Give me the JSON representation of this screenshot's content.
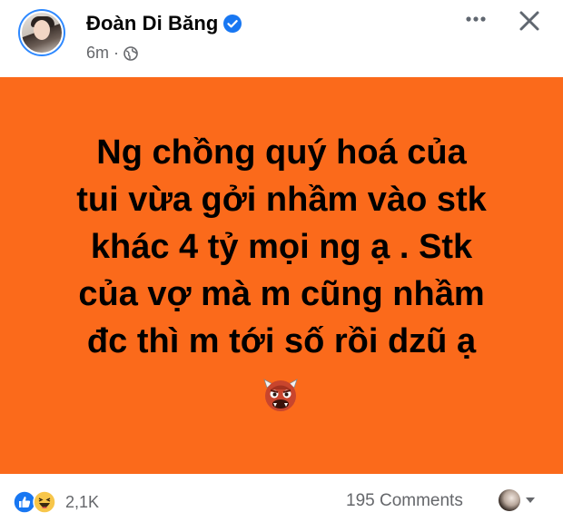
{
  "post": {
    "author_name": "Đoàn Di Băng",
    "timestamp": "6m",
    "separator": "·",
    "text_lines": [
      "Ng chồng quý hoá của",
      "tui vừa gởi nhầm vào stk",
      "khác 4 tỷ mọi ng ạ . Stk",
      "của vợ mà m cũng nhầm",
      "đc thì m tới số rồi dzũ ạ"
    ],
    "background_color": "#fb6a1b",
    "emoji": "ogre-face"
  },
  "footer": {
    "reaction_count": "2,1K",
    "comments_label": "195 Comments",
    "reaction_icons": [
      "like-icon",
      "haha-icon"
    ]
  },
  "colors": {
    "accent": "#1877f2",
    "secondary_text": "#65676b"
  }
}
